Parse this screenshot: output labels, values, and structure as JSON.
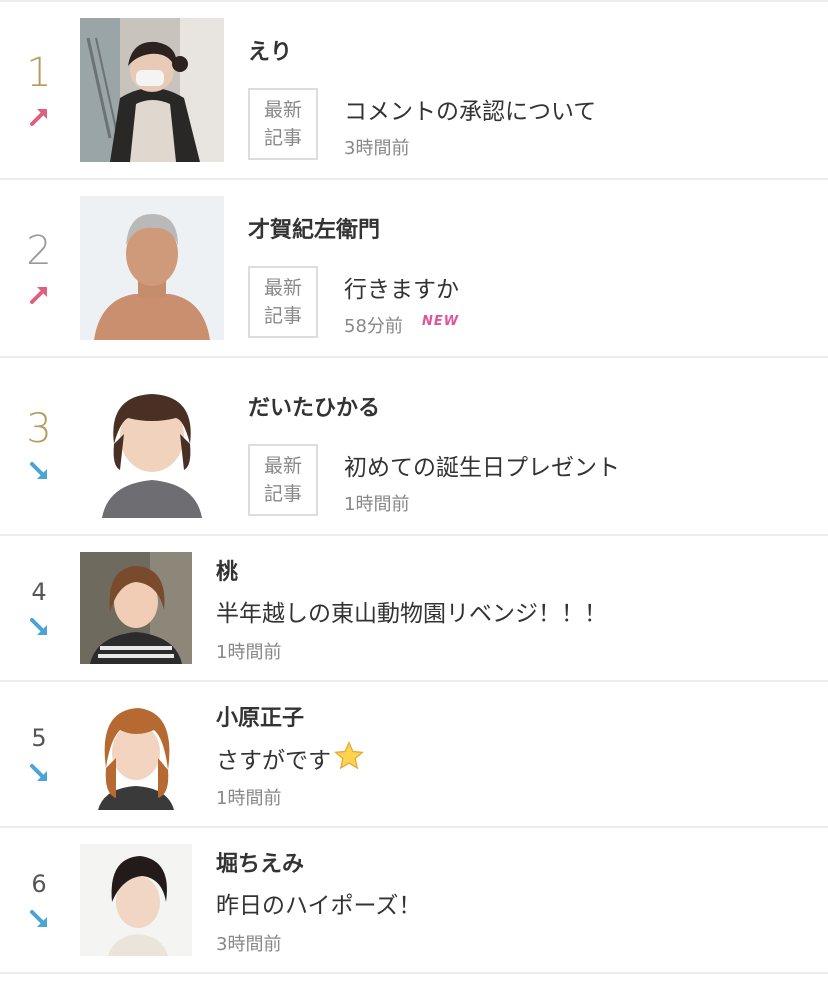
{
  "colors": {
    "up_arrow": "#e05f7f",
    "down_arrow": "#4ba3d8",
    "rank_gold": "#b69a5c",
    "rank_silver": "#9a9a9a",
    "new_badge": "#e0559a"
  },
  "tag": {
    "line1": "最新",
    "line2": "記事"
  },
  "rankings": [
    {
      "rank": "1",
      "trend": "up",
      "name": "えり",
      "title": "コメントの承認について",
      "time": "3時間前"
    },
    {
      "rank": "2",
      "trend": "up",
      "name": "才賀紀左衛門",
      "title": "行きますか",
      "time": "58分前",
      "badge": "NEW"
    },
    {
      "rank": "3",
      "trend": "down",
      "name": "だいたひかる",
      "title": "初めての誕生日プレゼント",
      "time": "1時間前"
    },
    {
      "rank": "4",
      "trend": "down",
      "name": "桃",
      "title": "半年越しの東山動物園リベンジ！！！",
      "time": "1時間前"
    },
    {
      "rank": "5",
      "trend": "down",
      "name": "小原正子",
      "title": "さすがです",
      "title_icon": "star-emoji",
      "time": "1時間前"
    },
    {
      "rank": "6",
      "trend": "down",
      "name": "堀ちえみ",
      "title": "昨日のハイポーズ！",
      "time": "3時間前"
    }
  ]
}
